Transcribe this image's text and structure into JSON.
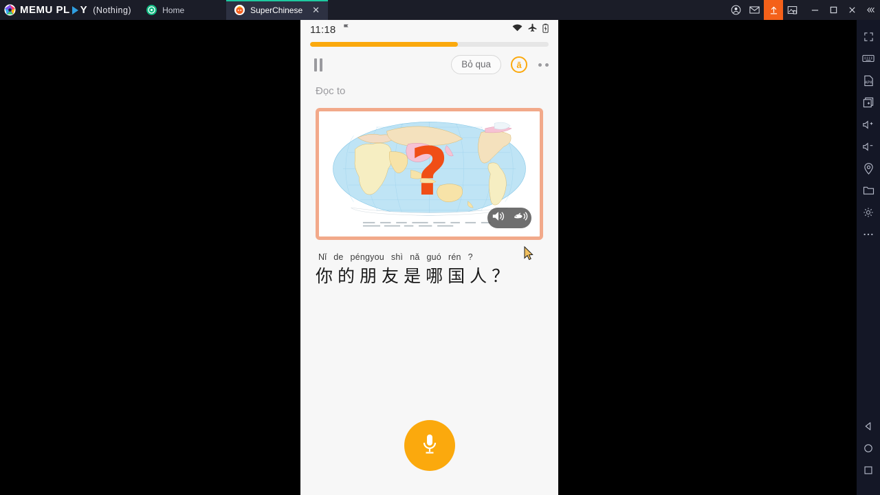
{
  "window": {
    "brand_name": "MEMU PL",
    "brand_name_tail": "Y",
    "brand_suffix": "(Nothing)",
    "logo_icon": "memu-logo-icon",
    "accent_color": "#f4611a",
    "tabs": [
      {
        "label": "Home",
        "icon": "home-tab-icon",
        "active": false,
        "closable": false
      },
      {
        "label": "SuperChinese",
        "icon": "superchinese-tab-icon",
        "active": true,
        "closable": true,
        "close_label": "✕"
      }
    ],
    "controls": [
      {
        "name": "account-icon",
        "glyph": "user"
      },
      {
        "name": "mail-icon",
        "glyph": "mail"
      },
      {
        "name": "upload-icon",
        "glyph": "upload",
        "accent": true
      },
      {
        "name": "screenshot-icon",
        "glyph": "screenshot"
      },
      {
        "name": "minimize-button",
        "glyph": "minimize"
      },
      {
        "name": "maximize-button",
        "glyph": "maximize"
      },
      {
        "name": "close-button",
        "glyph": "close"
      },
      {
        "name": "collapse-button",
        "glyph": "collapse"
      }
    ]
  },
  "rail": {
    "items": [
      {
        "name": "fullscreen-icon",
        "label": "Fullscreen"
      },
      {
        "name": "keyboard-icon",
        "label": "Keyboard"
      },
      {
        "name": "apk-install-icon",
        "label": "APK"
      },
      {
        "name": "multi-window-icon",
        "label": "Multi-window"
      },
      {
        "name": "volume-up-icon",
        "label": "Volume up"
      },
      {
        "name": "volume-down-icon",
        "label": "Volume down"
      },
      {
        "name": "location-icon",
        "label": "Location"
      },
      {
        "name": "folder-icon",
        "label": "Shared folder"
      },
      {
        "name": "settings-icon",
        "label": "Settings"
      },
      {
        "name": "more-icon",
        "label": "More"
      }
    ],
    "nav": [
      {
        "name": "android-back-button",
        "label": "Back"
      },
      {
        "name": "android-home-button",
        "label": "Home"
      },
      {
        "name": "android-recents-button",
        "label": "Recents"
      }
    ]
  },
  "phone": {
    "statusbar": {
      "time": "11:18",
      "left_icon": "signal-flag-icon",
      "right_icons": [
        "wifi-icon",
        "airplane-mode-icon",
        "battery-icon"
      ]
    },
    "progress": {
      "percent": 62,
      "fill_color": "#FBA90D",
      "track_color": "#e6e6e6"
    },
    "toolbar": {
      "pause_label": "Pause",
      "skip_label": "Bỏ qua",
      "pinyin_toggle_label": "ā",
      "more_label": "More options"
    },
    "task": {
      "instruction": "Đọc to"
    },
    "card": {
      "image_name": "world-map-with-question-mark",
      "question_mark": "?",
      "border_color": "#f2a98a",
      "audio": {
        "normal_speed_label": "Play audio",
        "slow_speed_label": "Play slowly"
      }
    },
    "sentence": {
      "pinyin": [
        "Nǐ",
        "de",
        "péngyou",
        "shì",
        "nǎ",
        "guó",
        "rén",
        "?"
      ],
      "hanzi": [
        "你",
        "的",
        "朋",
        "友",
        "是",
        "哪",
        "国",
        "人",
        "？"
      ]
    },
    "mic": {
      "label": "Record",
      "color": "#FBA90D"
    }
  }
}
